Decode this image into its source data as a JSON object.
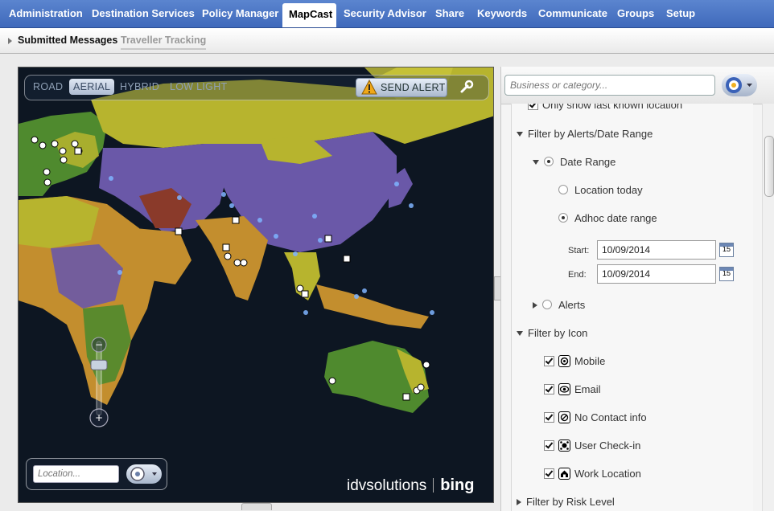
{
  "nav": {
    "tabs": [
      {
        "label": "Administration",
        "active": false
      },
      {
        "label": "Destination Services",
        "active": false
      },
      {
        "label": "Policy Manager",
        "active": false
      },
      {
        "label": "MapCast",
        "active": true
      },
      {
        "label": "Security Advisor",
        "active": false
      },
      {
        "label": "Share",
        "active": false
      },
      {
        "label": "Keywords",
        "active": false
      },
      {
        "label": "Communicate",
        "active": false
      },
      {
        "label": "Groups",
        "active": false
      },
      {
        "label": "Setup",
        "active": false
      }
    ]
  },
  "subnav": {
    "submitted": "Submitted Messages",
    "traveller": "Traveller Tracking"
  },
  "map": {
    "modes": [
      "ROAD",
      "AERIAL",
      "HYBRID",
      "LOW LIGHT"
    ],
    "active_mode": "AERIAL",
    "send_alert": "SEND ALERT",
    "location_placeholder": "Location...",
    "brand_left": "idvsolutions",
    "brand_right": "bing",
    "zoom_level": 0.22
  },
  "panel": {
    "search_placeholder": "Business or category...",
    "only_last_known": "Only show last known location",
    "filter_alerts_date": "Filter by Alerts/Date Range",
    "date_range": "Date Range",
    "location_today": "Location today",
    "adhoc": "Adhoc date range",
    "start_label": "Start:",
    "start_value": "10/09/2014",
    "end_label": "End:",
    "end_value": "10/09/2014",
    "calendar_day": "15",
    "alerts": "Alerts",
    "filter_icon": "Filter by Icon",
    "icons": [
      {
        "label": "Mobile",
        "checked": true
      },
      {
        "label": "Email",
        "checked": true
      },
      {
        "label": "No Contact info",
        "checked": true
      },
      {
        "label": "User Check-in",
        "checked": true
      },
      {
        "label": "Work Location",
        "checked": true
      }
    ],
    "filter_risk": "Filter by Risk Level"
  },
  "colors": {
    "nav_blue": "#4a76c6",
    "risk_yellow": "#b7b42e",
    "risk_orange": "#c38e2e",
    "risk_purple": "#6a58a8",
    "risk_green": "#4f8a2e",
    "risk_red": "#8a3a2a",
    "ocean": "#0d1622"
  }
}
